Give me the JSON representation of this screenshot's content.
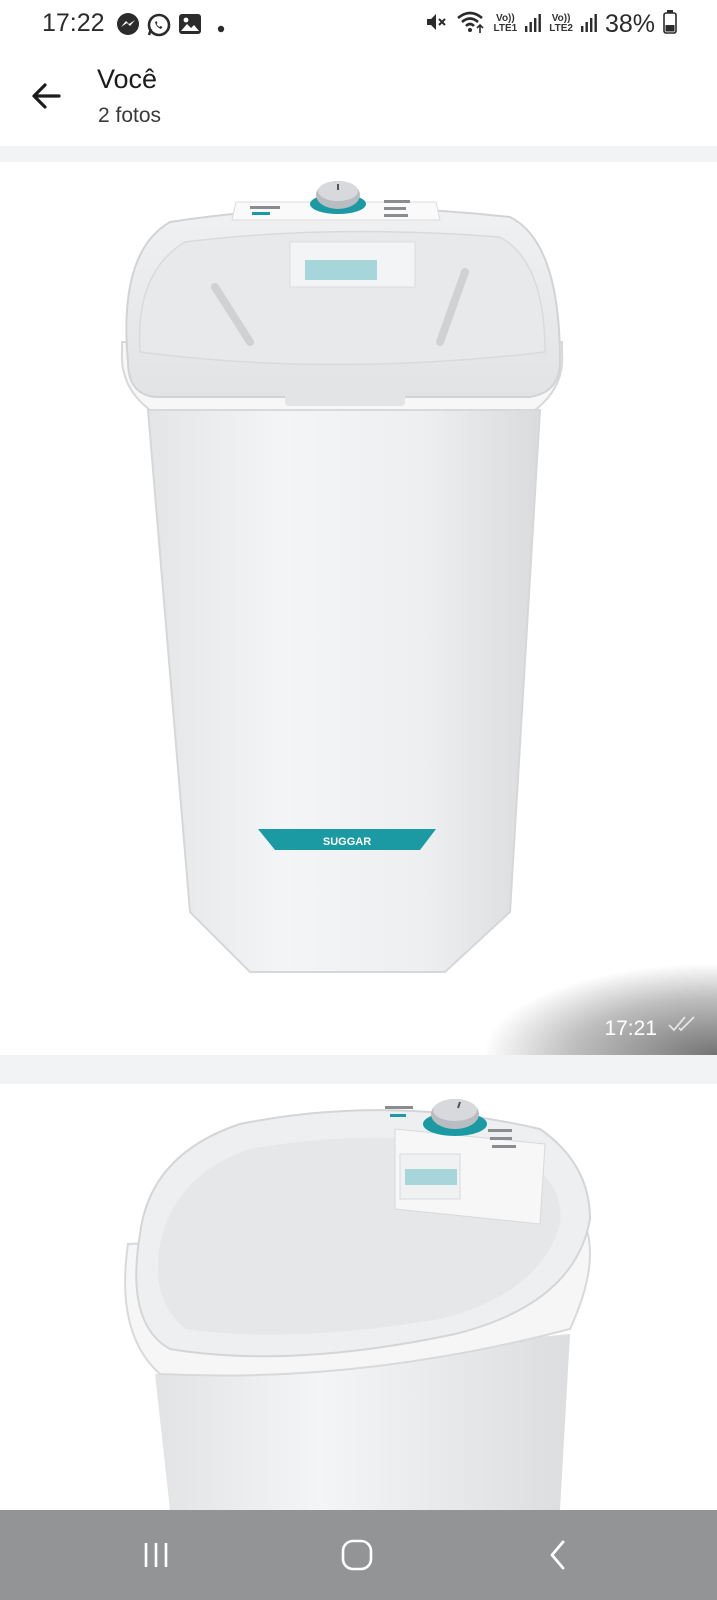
{
  "status_bar": {
    "time": "17:22",
    "notification_icons": [
      "messenger-icon",
      "whatsapp-icon",
      "gallery-icon",
      "more-dot-icon"
    ],
    "sim1_label_top": "Vo))",
    "sim1_label_bottom": "LTE1",
    "sim2_label_top": "Vo))",
    "sim2_label_bottom": "LTE2",
    "battery_percent": "38%",
    "battery_level": 0.38
  },
  "header": {
    "title": "Você",
    "subtitle": "2 fotos",
    "back_icon": "arrow-left-icon"
  },
  "photos": [
    {
      "brand_label": "SUGGAR",
      "time": "17:21",
      "status_icon": "double-check-icon"
    },
    {
      "brand_label": ""
    }
  ],
  "nav_bar": {
    "recents_icon": "recents-icon",
    "home_icon": "home-icon",
    "back_icon": "back-chevron-icon"
  },
  "colors": {
    "accent_teal": "#1b9aa3",
    "nav_bar": "#929496",
    "background": "#f2f3f5"
  }
}
